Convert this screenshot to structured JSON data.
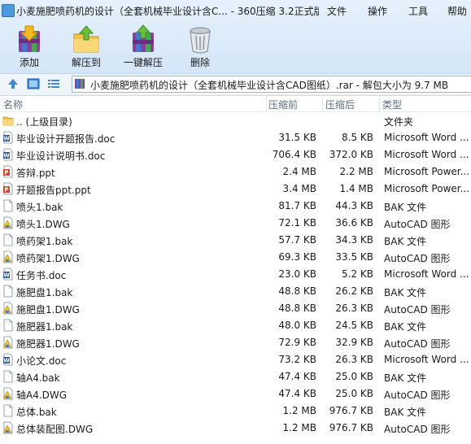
{
  "window": {
    "title": "小麦施肥喷药机的设计（全套机械毕业设计含C... - 360压缩 3.2正式版",
    "menu": [
      "文件",
      "操作",
      "工具",
      "帮助"
    ]
  },
  "toolbar": {
    "add_label": "添加",
    "extract_label": "解压到",
    "oneclick_label": "一键解压",
    "delete_label": "删除"
  },
  "address": {
    "path": "小麦施肥喷药机的设计（全套机械毕业设计含CAD图纸）.rar - 解包大小为 9.7 MB"
  },
  "columns": {
    "name": "名称",
    "compressed": "压缩前",
    "size": "压缩后",
    "type": "类型"
  },
  "files": [
    {
      "name": ".. (上级目录)",
      "compressed": "",
      "size": "",
      "type": "文件夹",
      "icon": "folder"
    },
    {
      "name": "毕业设计开题报告.doc",
      "compressed": "31.5 KB",
      "size": "8.5 KB",
      "type": "Microsoft Word ...",
      "icon": "word"
    },
    {
      "name": "毕业设计说明书.doc",
      "compressed": "706.4 KB",
      "size": "372.0 KB",
      "type": "Microsoft Word ...",
      "icon": "word"
    },
    {
      "name": "答辩.ppt",
      "compressed": "2.4 MB",
      "size": "2.2 MB",
      "type": "Microsoft Power...",
      "icon": "ppt"
    },
    {
      "name": "开题报告ppt.ppt",
      "compressed": "3.4 MB",
      "size": "1.4 MB",
      "type": "Microsoft Power...",
      "icon": "ppt"
    },
    {
      "name": "喷头1.bak",
      "compressed": "81.7 KB",
      "size": "44.3 KB",
      "type": "BAK 文件",
      "icon": "file"
    },
    {
      "name": "喷头1.DWG",
      "compressed": "72.1 KB",
      "size": "36.6 KB",
      "type": "AutoCAD 图形",
      "icon": "dwg"
    },
    {
      "name": "喷药架1.bak",
      "compressed": "57.7 KB",
      "size": "34.3 KB",
      "type": "BAK 文件",
      "icon": "file"
    },
    {
      "name": "喷药架1.DWG",
      "compressed": "69.3 KB",
      "size": "33.5 KB",
      "type": "AutoCAD 图形",
      "icon": "dwg"
    },
    {
      "name": "任务书.doc",
      "compressed": "23.0 KB",
      "size": "5.2 KB",
      "type": "Microsoft Word ...",
      "icon": "word"
    },
    {
      "name": "施肥盘1.bak",
      "compressed": "48.8 KB",
      "size": "26.2 KB",
      "type": "BAK 文件",
      "icon": "file"
    },
    {
      "name": "施肥盘1.DWG",
      "compressed": "48.8 KB",
      "size": "26.3 KB",
      "type": "AutoCAD 图形",
      "icon": "dwg"
    },
    {
      "name": "施肥器1.bak",
      "compressed": "48.0 KB",
      "size": "24.5 KB",
      "type": "BAK 文件",
      "icon": "file"
    },
    {
      "name": "施肥器1.DWG",
      "compressed": "72.9 KB",
      "size": "32.9 KB",
      "type": "AutoCAD 图形",
      "icon": "dwg"
    },
    {
      "name": "小论文.doc",
      "compressed": "73.2 KB",
      "size": "26.3 KB",
      "type": "Microsoft Word ...",
      "icon": "word"
    },
    {
      "name": "轴A4.bak",
      "compressed": "47.4 KB",
      "size": "25.0 KB",
      "type": "BAK 文件",
      "icon": "file"
    },
    {
      "name": "轴A4.DWG",
      "compressed": "47.4 KB",
      "size": "25.0 KB",
      "type": "AutoCAD 图形",
      "icon": "dwg"
    },
    {
      "name": "总体.bak",
      "compressed": "1.2 MB",
      "size": "976.7 KB",
      "type": "BAK 文件",
      "icon": "file"
    },
    {
      "name": "总体装配图.DWG",
      "compressed": "1.2 MB",
      "size": "976.7 KB",
      "type": "AutoCAD 图形",
      "icon": "dwg"
    }
  ],
  "colors": {
    "accent": "#2b6fc4",
    "toolbar_bg": "#dbeaf9",
    "word_icon": "#2b579a",
    "ppt_icon": "#d24726",
    "folder_icon": "#e8b84a",
    "dwg_icon": "#f2c230"
  }
}
